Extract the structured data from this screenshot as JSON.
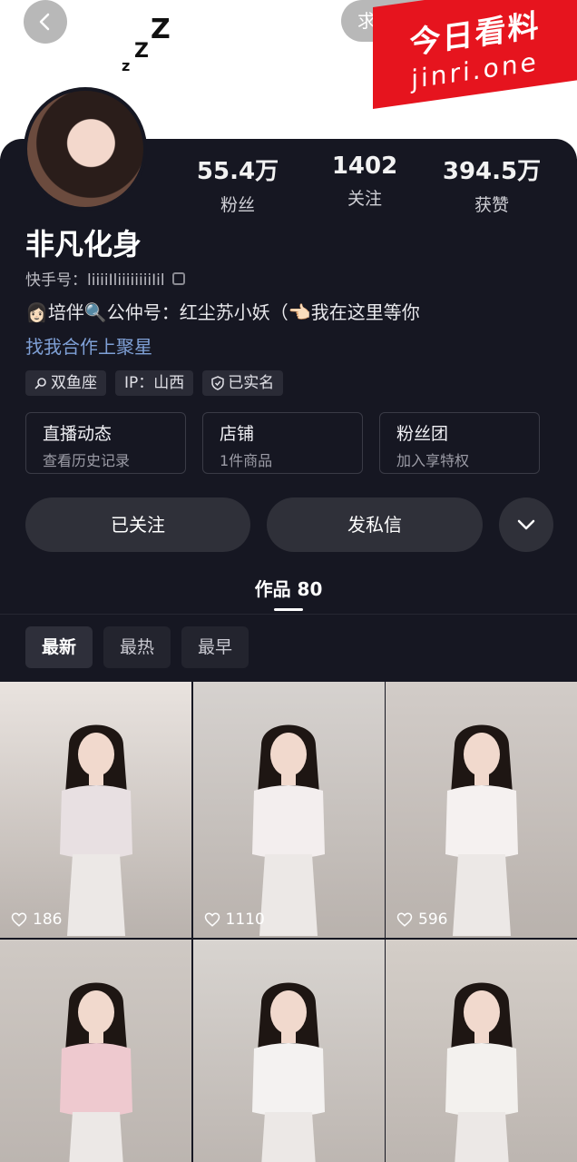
{
  "header": {
    "refresh_label": "求更新",
    "watermark_line1": "今日看料",
    "watermark_line2": "jinri.one"
  },
  "profile": {
    "name": "非凡化身",
    "kuaishou_id_label": "快手号：",
    "kuaishou_id_value": "liiiiIliiiiiiiiIil",
    "bio": "👩🏻培伴🔍公仲号：红尘苏小妖（👈🏻我在这里等你",
    "business_link": "找我合作上聚星",
    "stats": [
      {
        "value": "55.4万",
        "label": "粉丝"
      },
      {
        "value": "1402",
        "label": "关注"
      },
      {
        "value": "394.5万",
        "label": "获赞"
      }
    ],
    "tags": [
      {
        "icon": "search-icon",
        "label": "双鱼座"
      },
      {
        "icon": "",
        "label": "IP：山西"
      },
      {
        "icon": "shield-icon",
        "label": "已实名"
      }
    ],
    "cards": [
      {
        "title": "直播动态",
        "subtitle": "查看历史记录"
      },
      {
        "title": "店铺",
        "subtitle": "1件商品"
      },
      {
        "title": "粉丝团",
        "subtitle": "加入享特权"
      }
    ],
    "buttons": {
      "followed": "已关注",
      "message": "发私信"
    }
  },
  "works": {
    "tab_label": "作品 80",
    "sort_options": [
      "最新",
      "最热",
      "最早"
    ],
    "active_sort": "最新",
    "videos": [
      {
        "likes": "186",
        "bg": "#e9e3df",
        "shirt": "#e8e0e2"
      },
      {
        "likes": "1110",
        "bg": "#d6d2cf",
        "shirt": "#f3eeee"
      },
      {
        "likes": "596",
        "bg": "#d2ccc8",
        "shirt": "#f5f1f0"
      },
      {
        "likes": "",
        "bg": "#cfc9c4",
        "shirt": "#eec9cf"
      },
      {
        "likes": "",
        "bg": "#d8d4d0",
        "shirt": "#f4f2f1"
      },
      {
        "likes": "",
        "bg": "#d4cec8",
        "shirt": "#f3f1ee"
      }
    ]
  }
}
